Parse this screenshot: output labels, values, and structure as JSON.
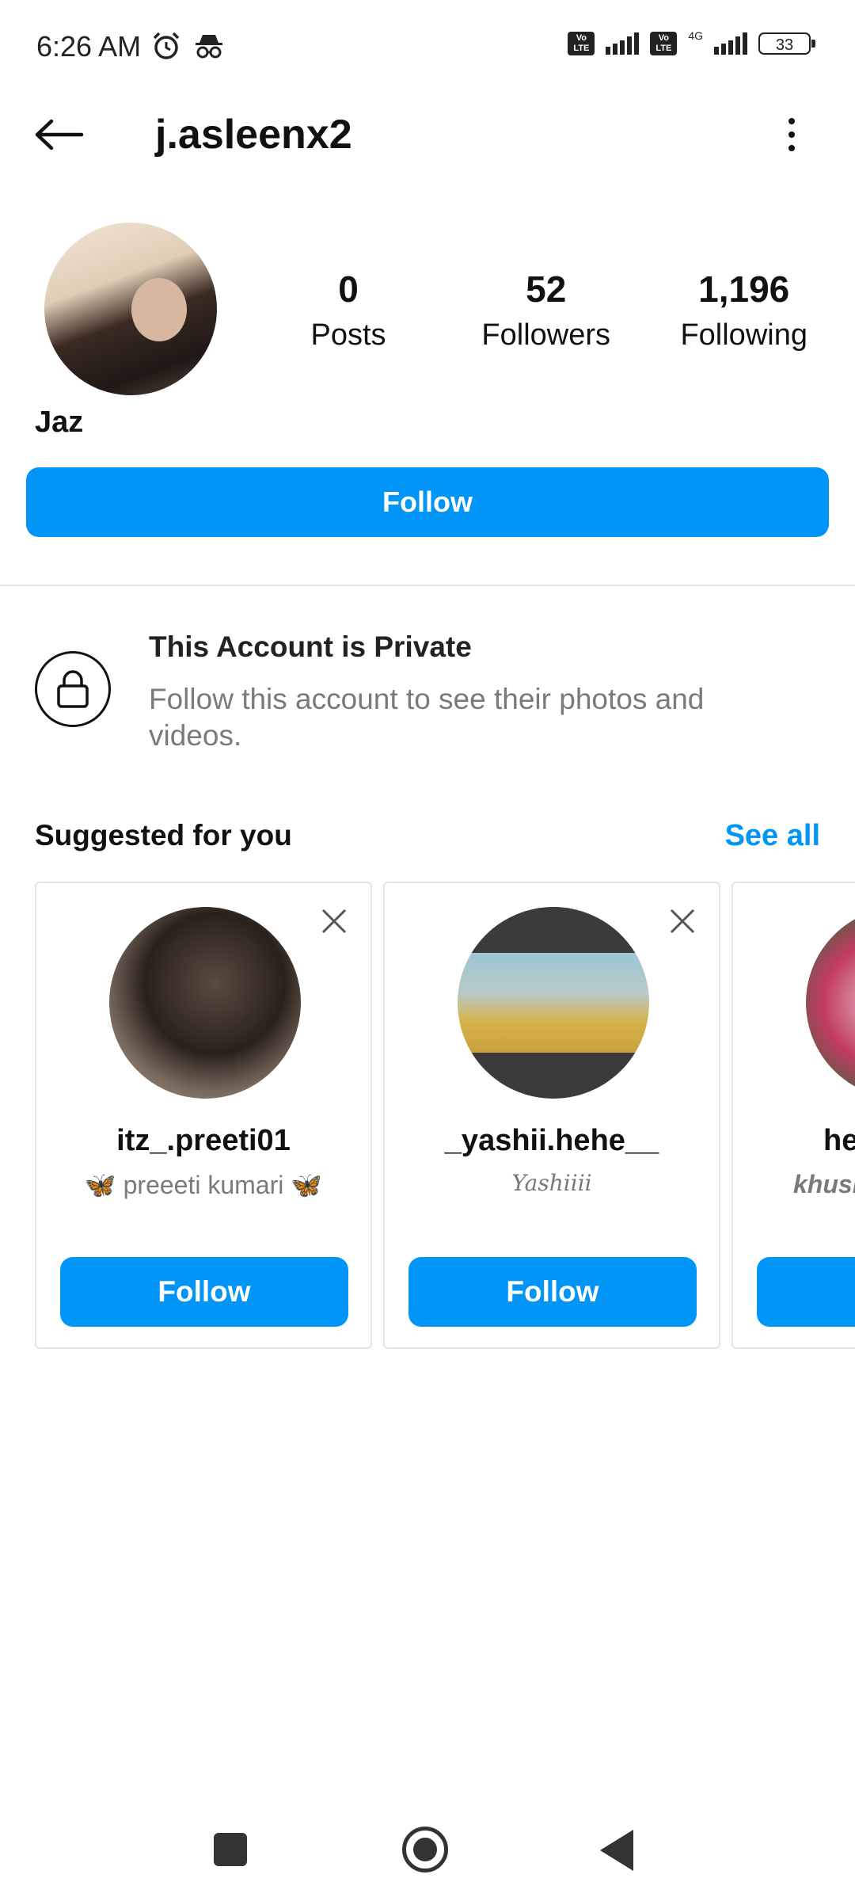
{
  "status_bar": {
    "time": "6:26 AM",
    "icons": [
      "alarm-icon",
      "incognito-icon"
    ],
    "network": "4G",
    "battery": "33"
  },
  "header": {
    "username": "j.asleenx2"
  },
  "profile": {
    "display_name": "Jaz",
    "stats": [
      {
        "value": "0",
        "label": "Posts"
      },
      {
        "value": "52",
        "label": "Followers"
      },
      {
        "value": "1,196",
        "label": "Following"
      }
    ],
    "follow_label": "Follow"
  },
  "private_notice": {
    "title": "This Account is Private",
    "description": "Follow this account to see their photos and videos."
  },
  "suggested": {
    "title": "Suggested for you",
    "see_all": "See all",
    "cards": [
      {
        "username": "itz_.preeti01",
        "full_name": "🦋 preeeti kumari 🦋",
        "follow_label": "Follow"
      },
      {
        "username": "_yashii.hehe__",
        "full_name": "Yashiiii",
        "follow_label": "Follow"
      },
      {
        "username": "he",
        "full_name": "khusl",
        "follow_label": ""
      }
    ]
  },
  "colors": {
    "accent": "#0095f6",
    "secondary_text": "#7a7a7a"
  }
}
